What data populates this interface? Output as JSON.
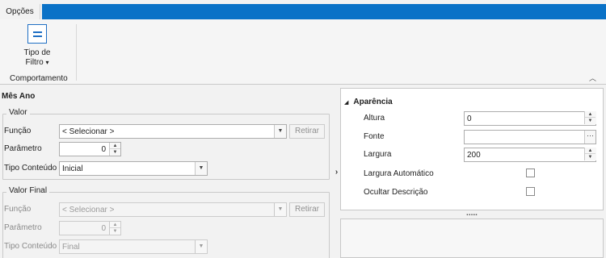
{
  "ribbon": {
    "tab_label": "Opções",
    "filter_button": {
      "line1": "Tipo de",
      "line2": "Filtro",
      "dropdown_glyph": "▾",
      "icon": "equals-icon"
    },
    "group_label": "Comportamento",
    "collapse_glyph": "︿"
  },
  "panel": {
    "title": "Mês Ano",
    "valor": {
      "legend": "Valor",
      "funcao_label": "Função",
      "funcao_value": "< Selecionar >",
      "retirar_label": "Retirar",
      "parametro_label": "Parâmetro",
      "parametro_value": "0",
      "tipo_label": "Tipo Conteúdo",
      "tipo_value": "Inicial"
    },
    "valor_final": {
      "legend": "Valor Final",
      "funcao_label": "Função",
      "funcao_value": "< Selecionar >",
      "retirar_label": "Retirar",
      "parametro_label": "Parâmetro",
      "parametro_value": "0",
      "tipo_label": "Tipo Conteúdo",
      "tipo_value": "Final"
    }
  },
  "splitter": {
    "arrow_glyph": "›"
  },
  "properties": {
    "section_label": "Aparência",
    "section_glyph": "◢",
    "rows": [
      {
        "label": "Altura",
        "value": "0"
      },
      {
        "label": "Fonte",
        "value": ""
      },
      {
        "label": "Largura",
        "value": "200"
      },
      {
        "label": "Largura Automático"
      },
      {
        "label": "Ocultar Descrição"
      }
    ],
    "ellipsis_glyph": "···",
    "resize_dots": "....."
  },
  "glyphs": {
    "up": "▲",
    "down": "▼"
  },
  "colors": {
    "ribbon_blue": "#0a72c7",
    "icon_blue": "#1f6fc4"
  }
}
